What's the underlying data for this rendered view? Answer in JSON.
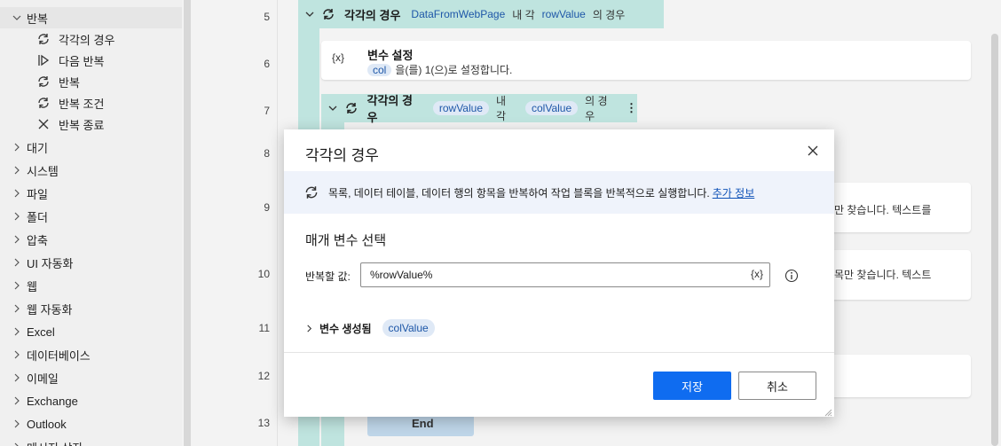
{
  "sidebar": {
    "loop_group": {
      "label": "반복",
      "children": [
        {
          "label": "각각의 경우",
          "icon": "loop-each-icon"
        },
        {
          "label": "다음 반복",
          "icon": "next-loop-icon"
        },
        {
          "label": "반복",
          "icon": "loop-icon"
        },
        {
          "label": "반복 조건",
          "icon": "loop-condition-icon"
        },
        {
          "label": "반복 종료",
          "icon": "exit-loop-icon"
        }
      ]
    },
    "groups": [
      {
        "label": "대기"
      },
      {
        "label": "시스템"
      },
      {
        "label": "파일"
      },
      {
        "label": "폴더"
      },
      {
        "label": "압축"
      },
      {
        "label": "UI 자동화"
      },
      {
        "label": "웹"
      },
      {
        "label": "웹 자동화"
      },
      {
        "label": "Excel"
      },
      {
        "label": "데이터베이스"
      },
      {
        "label": "이메일"
      },
      {
        "label": "Exchange"
      },
      {
        "label": "Outlook"
      },
      {
        "label": "메시지 상자"
      }
    ]
  },
  "line_numbers": [
    "5",
    "6",
    "7",
    "8",
    "9",
    "10",
    "11",
    "12",
    "13"
  ],
  "flow": {
    "loop1": {
      "title": "각각의 경우",
      "var_in": "DataFromWebPage",
      "mid": "내 각",
      "var_item": "rowValue",
      "suffix": "의 경우"
    },
    "set_var": {
      "icon_text": "{x}",
      "title": "변수 설정",
      "var": "col",
      "desc": "을(를) 1(으)로 설정합니다."
    },
    "loop2": {
      "title": "각각의 경우",
      "var_in": "rowValue",
      "mid": "내 각",
      "var_item": "colValue",
      "suffix": "의 경우"
    },
    "fragment_9": "만 찾습니다. 텍스트를",
    "fragment_10": "목만 찾습니다. 텍스트",
    "end_label": "End"
  },
  "dialog": {
    "title": "각각의 경우",
    "info_text": "목록, 데이터 테이블, 데이터 행의 항목을 반복하여 작업 블록을 반복적으로 실행합니다.",
    "info_link": "추가 정보",
    "section_title": "매개 변수 선택",
    "field_label": "반복할 값:",
    "field_value": "%rowValue%",
    "field_var_button": "{x}",
    "produced_vars_label": "변수 생성됨",
    "produced_var": "colValue",
    "save_label": "저장",
    "cancel_label": "취소"
  },
  "colors": {
    "loop_header": "#bfe4df",
    "var_tag_bg": "#dfe9f6",
    "var_tag_fg": "#1e57a8",
    "primary_button": "#0f6cf0",
    "info_band": "#eff3fb"
  }
}
